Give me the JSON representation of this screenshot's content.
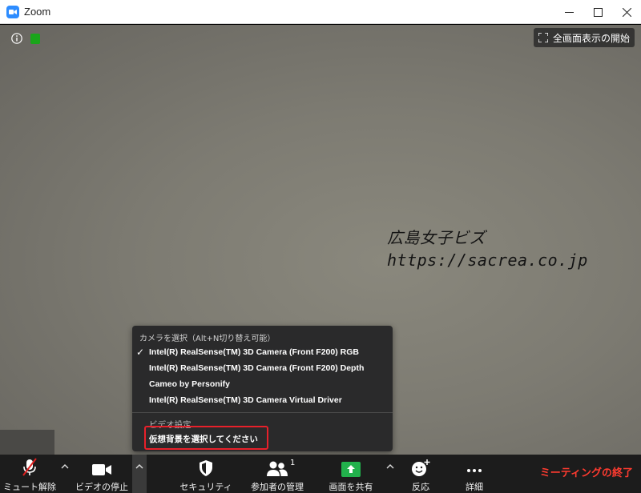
{
  "window": {
    "title": "Zoom"
  },
  "video": {
    "fullscreen_label": "全画面表示の開始",
    "watermark_line1": "広島女子ビズ",
    "watermark_line2": "https://sacrea.co.jp"
  },
  "camera_menu": {
    "header": "カメラを選択（Alt+N切り替え可能）",
    "cameras": [
      "Intel(R) RealSense(TM) 3D Camera (Front F200) RGB",
      "Intel(R) RealSense(TM) 3D Camera (Front F200) Depth",
      "Cameo by Personify",
      "Intel(R) RealSense(TM) 3D Camera Virtual Driver"
    ],
    "selected_index": 0,
    "video_settings": "ビデオ設定...",
    "virtual_background": "仮想背景を選択してください"
  },
  "toolbar": {
    "unmute": "ミュート解除",
    "stop_video": "ビデオの停止",
    "security": "セキュリティ",
    "participants": "参加者の管理",
    "participants_count": "1",
    "share_screen": "画面を共有",
    "reactions": "反応",
    "more": "詳細",
    "end_meeting": "ミーティングの終了"
  },
  "colors": {
    "accent": "#2d8cff",
    "share_green": "#22b14c",
    "end_red": "#ff3b30",
    "highlight_red": "#e8202a"
  }
}
